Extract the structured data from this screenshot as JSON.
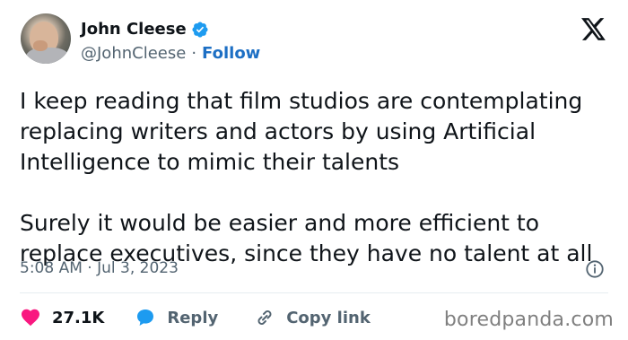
{
  "author": {
    "name": "John Cleese",
    "handle": "@JohnCleese",
    "separator": "·",
    "follow_label": "Follow"
  },
  "tweet": {
    "paragraphs": [
      "I keep reading that film studios are contemplating replacing writers and actors by using Artificial Intelligence to mimic their talents",
      "Surely it would be easier and more efficient to replace executives, since they have no talent at all"
    ],
    "timestamp": "5:08 AM · Jul 3, 2023"
  },
  "actions": {
    "likes_count": "27.1K",
    "reply_label": "Reply",
    "copy_link_label": "Copy link"
  },
  "watermark": "boredpanda.com",
  "colors": {
    "verified": "#1d9bf0",
    "follow": "#1d6fc4",
    "heart": "#f91880",
    "reply_bubble": "#1d9bf0",
    "muted": "#536471"
  },
  "icons": [
    "verified-badge-icon",
    "x-logo-icon",
    "info-icon",
    "heart-icon",
    "reply-bubble-icon",
    "link-icon"
  ]
}
